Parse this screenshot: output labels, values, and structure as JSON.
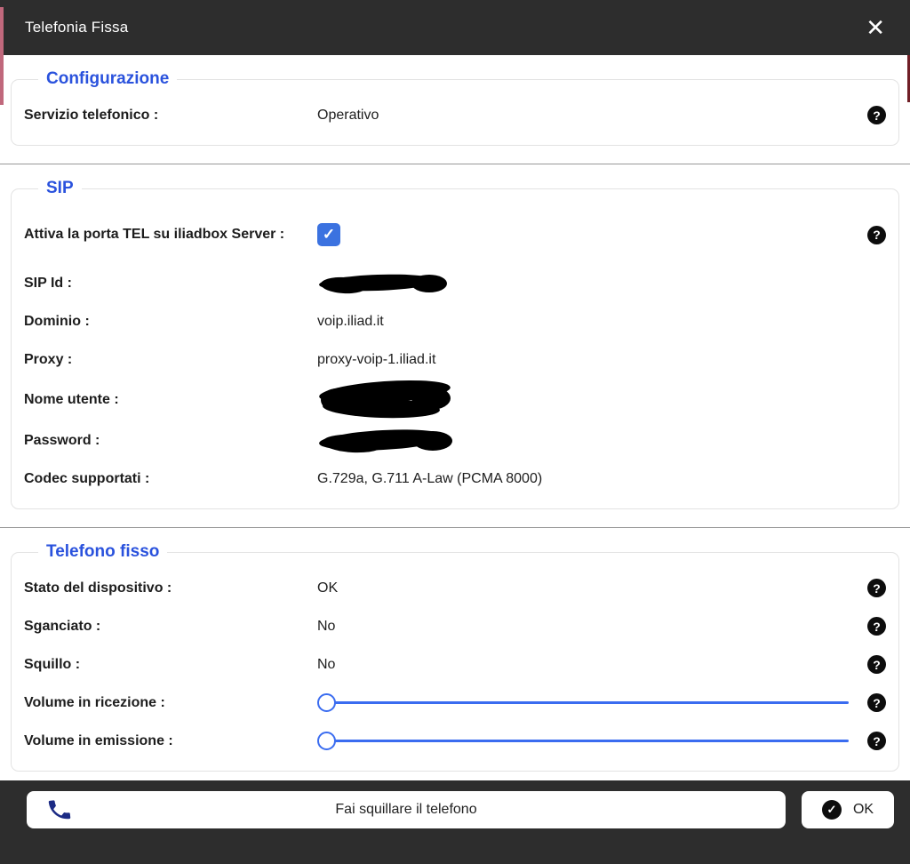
{
  "header": {
    "title": "Telefonia Fissa"
  },
  "icons": {
    "close": "✕",
    "help": "?",
    "check": "✓",
    "phone": "phone-handset"
  },
  "colors": {
    "titlebar_bg": "#2d2d2d",
    "accent_blue": "#2a52dd",
    "checkbox_blue": "#3b72e0",
    "slider_blue": "#3a6cf0",
    "help_icon_bg": "#0d0d0d",
    "phone_icon_navy": "#1c2b85"
  },
  "sections": {
    "configurazione": {
      "legend": "Configurazione",
      "rows": {
        "servizio": {
          "label": "Servizio telefonico :",
          "value": "Operativo"
        }
      }
    },
    "sip": {
      "legend": "SIP",
      "rows": {
        "attiva": {
          "label": "Attiva la porta TEL su iliadbox Server :",
          "checked": true
        },
        "sip_id": {
          "label": "SIP Id :",
          "value": "",
          "redacted": true
        },
        "dominio": {
          "label": "Dominio :",
          "value": "voip.iliad.it"
        },
        "proxy": {
          "label": "Proxy :",
          "value": "proxy-voip-1.iliad.it"
        },
        "nome_utente": {
          "label": "Nome utente :",
          "value": "",
          "redacted": true
        },
        "password": {
          "label": "Password :",
          "value": "",
          "redacted": true
        },
        "codec": {
          "label": "Codec supportati :",
          "value": "G.729a, G.711 A-Law (PCMA 8000)"
        }
      }
    },
    "telefono_fisso": {
      "legend": "Telefono fisso",
      "rows": {
        "stato": {
          "label": "Stato del dispositivo :",
          "value": "OK"
        },
        "sganciato": {
          "label": "Sganciato :",
          "value": "No"
        },
        "squillo": {
          "label": "Squillo :",
          "value": "No"
        },
        "volume_ricezione": {
          "label": "Volume in ricezione :",
          "slider": {
            "value": 0,
            "min": 0,
            "max": 100
          }
        },
        "volume_emissione": {
          "label": "Volume in emissione :",
          "slider": {
            "value": 0,
            "min": 0,
            "max": 100
          }
        }
      }
    }
  },
  "footer": {
    "ring_button_label": "Fai squillare il telefono",
    "ok_button_label": "OK"
  }
}
